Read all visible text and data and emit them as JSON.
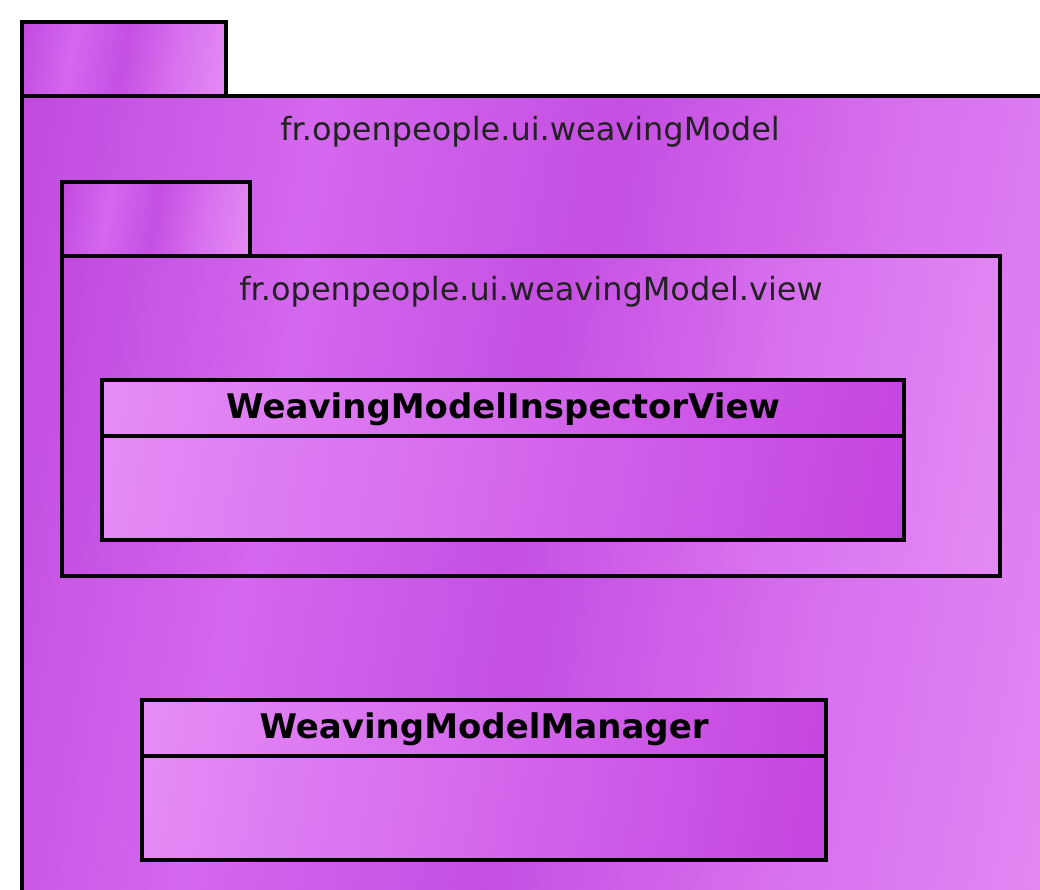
{
  "package": {
    "name": "fr.openpeople.ui.weavingModel",
    "children": [
      {
        "kind": "package",
        "name": "fr.openpeople.ui.weavingModel.view",
        "children": [
          {
            "kind": "class",
            "name": "WeavingModelInspectorView"
          }
        ]
      },
      {
        "kind": "class",
        "name": "WeavingModelManager"
      }
    ]
  }
}
